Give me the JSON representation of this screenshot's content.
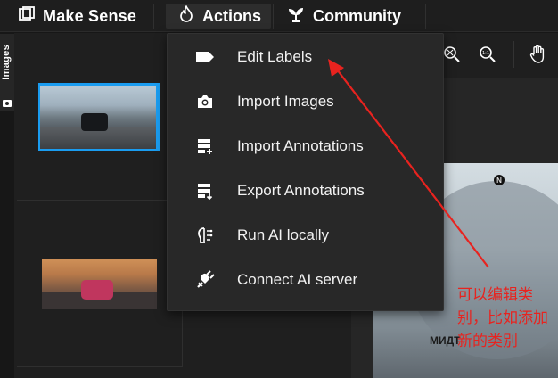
{
  "header": {
    "brand": "Make Sense",
    "nav": [
      {
        "label": "Actions",
        "icon": "flame-icon"
      },
      {
        "label": "Community",
        "icon": "sprout-icon"
      }
    ]
  },
  "sidebar_tab": {
    "label": "Images",
    "icon": "camera-icon"
  },
  "actions_menu": {
    "items": [
      {
        "label": "Edit Labels",
        "icon": "tag-icon"
      },
      {
        "label": "Import Images",
        "icon": "camera-icon"
      },
      {
        "label": "Import Annotations",
        "icon": "import-annotations-icon"
      },
      {
        "label": "Export Annotations",
        "icon": "export-annotations-icon"
      },
      {
        "label": "Run AI locally",
        "icon": "ai-brain-icon"
      },
      {
        "label": "Connect AI server",
        "icon": "plug-icon"
      }
    ]
  },
  "toolbar": {
    "icons": [
      "zoom-fit-icon",
      "zoom-actual-icon",
      "hand-icon"
    ],
    "zoom_actual_label": "1:1"
  },
  "editor": {
    "photo_text": "МИДТ",
    "badge_letter": "N"
  },
  "annotation": {
    "text": "可以编辑类别，比如添加新的类别",
    "color": "#e8231f"
  },
  "colors": {
    "selection_border": "#1a9cf0",
    "menu_bg": "#282828",
    "topbar_bg": "#1e1e1e"
  }
}
